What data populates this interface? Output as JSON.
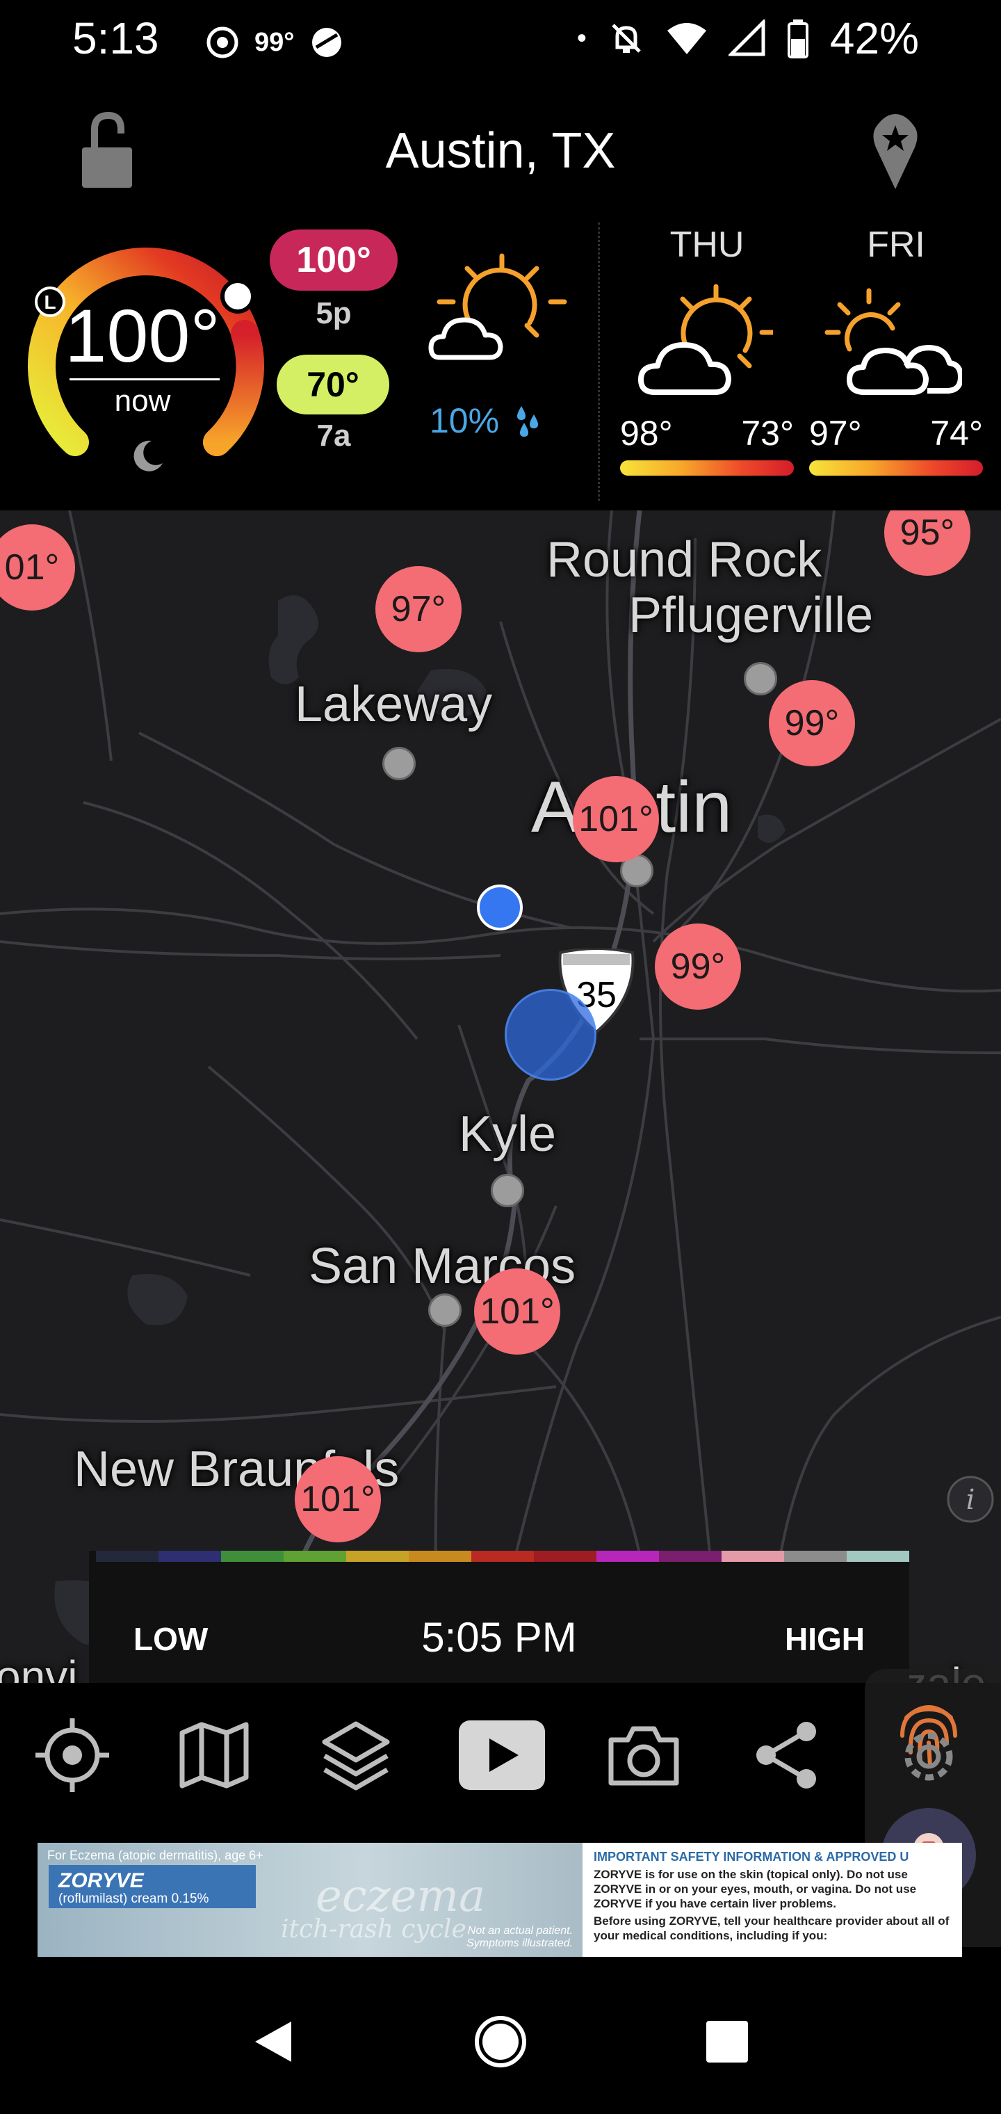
{
  "status_bar": {
    "time": "5:13",
    "temp": "99°",
    "dot": "•",
    "battery": "42%",
    "icons": [
      "chrome-icon",
      "weather-icon",
      "podcast-icon",
      "notifications-off-icon",
      "wifi-icon",
      "signal-icon",
      "battery-icon"
    ]
  },
  "header": {
    "city": "Austin, TX"
  },
  "current": {
    "temp": "100°",
    "label": "now",
    "gauge_marker": "L",
    "high": "100°",
    "high_time": "5p",
    "low": "70°",
    "low_time": "7a",
    "precip": "10%",
    "condition_icon": "partly-sunny-icon"
  },
  "forecast": [
    {
      "day": "THU",
      "high": "98°",
      "low": "73°",
      "icon": "partly-sunny-icon"
    },
    {
      "day": "FRI",
      "high": "97°",
      "low": "74°",
      "icon": "mostly-cloudy-icon"
    }
  ],
  "map": {
    "places": [
      {
        "name": "Round Rock"
      },
      {
        "name": "Pflugerville"
      },
      {
        "name": "Lakeway"
      },
      {
        "name": "Austin"
      },
      {
        "name": "Kyle"
      },
      {
        "name": "San Marcos"
      },
      {
        "name": "New Braunfels"
      },
      {
        "name": "onvi"
      },
      {
        "name": "Gonzale"
      }
    ],
    "temps": [
      "01°",
      "97°",
      "95°",
      "99°",
      "101°",
      "99°",
      "101°",
      "101°"
    ],
    "highway": "35"
  },
  "legend": {
    "low": "LOW",
    "time": "5:05 PM",
    "high": "HIGH",
    "colors": [
      "#23283a",
      "#2d2f72",
      "#3f8f3a",
      "#5fa132",
      "#c6a226",
      "#c88a1f",
      "#b82a22",
      "#9e1d22",
      "#b626b8",
      "#7a1e6e",
      "#e39ba7",
      "#8c8c8c",
      "#a3c7c1"
    ]
  },
  "toolbar": {
    "items": [
      "locate-icon",
      "map-icon",
      "layers-icon",
      "play-icon",
      "camera-icon",
      "share-icon",
      "settings-icon"
    ]
  },
  "ad": {
    "tag": "For Eczema (atopic dermatitis), age 6+",
    "brand": "ZORYVE",
    "brand_sub": "(roflumilast) cream 0.15%",
    "word": "eczema",
    "word2": "itch-rash cycle",
    "note_line1": "Not an actual patient.",
    "note_line2": "Symptoms illustrated.",
    "headline": "IMPORTANT SAFETY INFORMATION & APPROVED U",
    "body1": "ZORYVE is for use on the skin (topical only). Do not use ZORYVE in or on your eyes, mouth, or vagina. Do not use ZORYVE if you have certain liver problems.",
    "body2": "Before using ZORYVE, tell your healthcare provider about all of your medical conditions, including if you:"
  }
}
